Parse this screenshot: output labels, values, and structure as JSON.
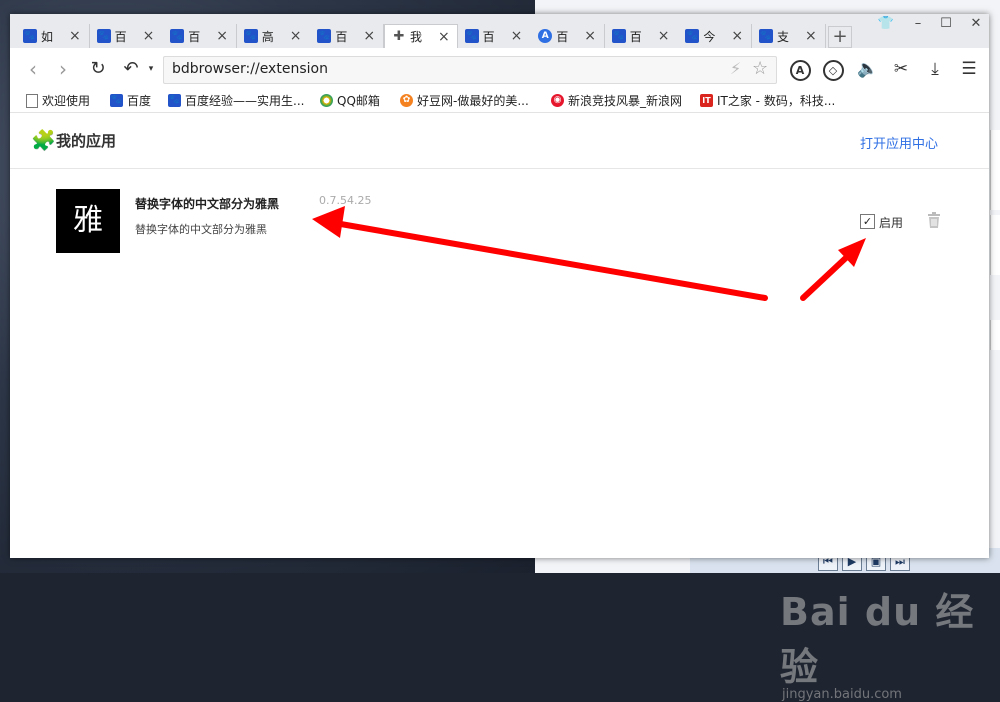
{
  "tabs": [
    {
      "title": "如",
      "icon": "baidu-paw-icon"
    },
    {
      "title": "百",
      "icon": "baidu-paw-icon"
    },
    {
      "title": "百",
      "icon": "baidu-paw-icon"
    },
    {
      "title": "高",
      "icon": "baidu-paw-icon"
    },
    {
      "title": "百",
      "icon": "baidu-paw-icon"
    },
    {
      "title": "我",
      "icon": "puzzle-icon",
      "active": true
    },
    {
      "title": "百",
      "icon": "baidu-paw-icon"
    },
    {
      "title": "百",
      "icon": "a-circle-icon"
    },
    {
      "title": "百",
      "icon": "baidu-paw-icon"
    },
    {
      "title": "今",
      "icon": "baidu-paw-icon"
    },
    {
      "title": "支",
      "icon": "baidu-paw-icon"
    }
  ],
  "new_tab_label": "+",
  "window_controls": {
    "skin": "👕",
    "minimize": "–",
    "maximize": "☐",
    "close": "✕"
  },
  "toolbar": {
    "url": "bdbrowser://extension"
  },
  "bookmarks": [
    {
      "label": "欢迎使用",
      "icon": "page-icon"
    },
    {
      "label": "百度",
      "icon": "baidu-paw-icon"
    },
    {
      "label": "百度经验——实用生...",
      "icon": "baidu-paw-icon"
    },
    {
      "label": "QQ邮箱",
      "icon": "qq-icon"
    },
    {
      "label": "好豆网-做最好的美...",
      "icon": "haodou-icon"
    },
    {
      "label": "新浪竞技风暴_新浪网",
      "icon": "sina-icon"
    },
    {
      "label": "IT之家 - 数码，科技...",
      "icon": "ithome-icon"
    }
  ],
  "section": {
    "title": "我的应用",
    "open_center_label": "打开应用中心"
  },
  "extension": {
    "icon_char": "雅",
    "name": "替换字体的中文部分为雅黑",
    "version": "0.7.54.25",
    "description": "替换字体的中文部分为雅黑",
    "enabled": true,
    "enable_label": "启用",
    "check_mark": "✓"
  },
  "watermark": {
    "brand": "Bai du 经验",
    "url": "jingyan.baidu.com"
  },
  "colors": {
    "accent_blue": "#2f6fe4",
    "annotation_red": "#ff0000",
    "baidu_blue": "#2253c9"
  }
}
